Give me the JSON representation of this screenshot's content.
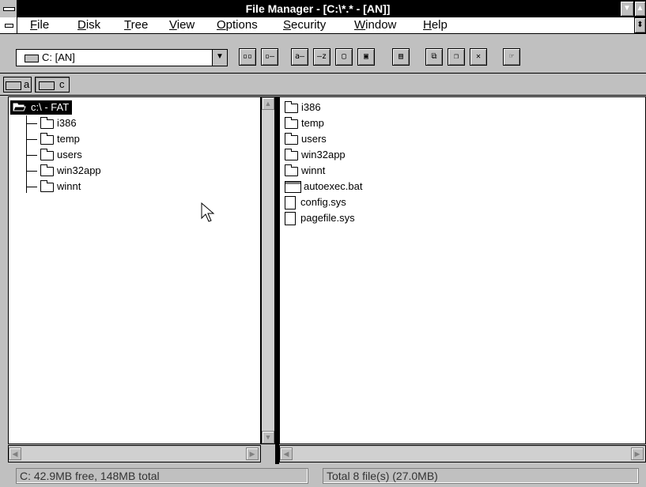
{
  "window": {
    "title": "File Manager - [C:\\*.* - [AN]]"
  },
  "menu": {
    "items": [
      {
        "label": "File",
        "ul": "F",
        "rest": "ile"
      },
      {
        "label": "Disk",
        "ul": "D",
        "rest": "isk"
      },
      {
        "label": "Tree",
        "ul": "T",
        "rest": "ree"
      },
      {
        "label": "View",
        "ul": "V",
        "rest": "iew"
      },
      {
        "label": "Options",
        "ul": "O",
        "rest": "ptions"
      },
      {
        "label": "Security",
        "ul": "S",
        "rest": "ecurity"
      },
      {
        "label": "Window",
        "ul": "W",
        "rest": "indow"
      },
      {
        "label": "Help",
        "ul": "H",
        "rest": "elp"
      }
    ]
  },
  "toolbar": {
    "drive_selected": "C: [AN]",
    "buttons": [
      "connect-net-drive",
      "disconnect-net-drive",
      "view-name",
      "view-all-details",
      "sort-by-name",
      "sort-by-type",
      "new-window",
      "copy",
      "move",
      "delete",
      "search",
      "print-preview"
    ]
  },
  "drives": [
    {
      "label": "a"
    },
    {
      "label": "c"
    }
  ],
  "tree": {
    "root": "c:\\ - FAT",
    "items": [
      "i386",
      "temp",
      "users",
      "win32app",
      "winnt"
    ]
  },
  "files": [
    {
      "name": "i386",
      "type": "folder"
    },
    {
      "name": "temp",
      "type": "folder"
    },
    {
      "name": "users",
      "type": "folder"
    },
    {
      "name": "win32app",
      "type": "folder"
    },
    {
      "name": "winnt",
      "type": "folder"
    },
    {
      "name": "autoexec.bat",
      "type": "executable"
    },
    {
      "name": "config.sys",
      "type": "file"
    },
    {
      "name": "pagefile.sys",
      "type": "file"
    }
  ],
  "status": {
    "left": "C: 42.9MB free,  148MB total",
    "right": "Total 8 file(s) (27.0MB)"
  }
}
